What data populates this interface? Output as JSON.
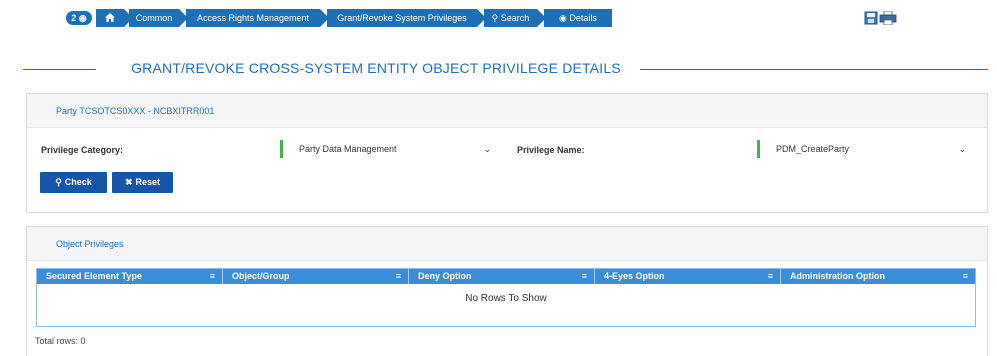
{
  "breadcrumb": {
    "badge": "2",
    "badge_icon": "eye-icon",
    "items": [
      {
        "label": "",
        "icon": "home-icon"
      },
      {
        "label": "Common"
      },
      {
        "label": "Access Rights Management"
      },
      {
        "label": "Grant/Revoke System Privileges"
      },
      {
        "label": "Search",
        "icon": "search-icon"
      },
      {
        "label": "Details",
        "icon": "eye-icon"
      }
    ]
  },
  "toolbar": {
    "icons": [
      "save-icon",
      "print-icon"
    ]
  },
  "page": {
    "title": "GRANT/REVOKE CROSS-SYSTEM ENTITY OBJECT PRIVILEGE DETAILS"
  },
  "party_panel": {
    "header": "Party TCSOTCS0XXX - NCBXITRR001",
    "privilege_category_label": "Privilege Category:",
    "privilege_category_value": "Party Data Management",
    "privilege_name_label": "Privilege Name:",
    "privilege_name_value": "PDM_CreateParty",
    "check_label": "Check",
    "reset_label": "Reset"
  },
  "object_privileges": {
    "header": "Object Privileges",
    "columns": [
      "Secured Element Type",
      "Object/Group",
      "Deny Option",
      "4-Eyes Option",
      "Administration Option"
    ],
    "empty_text": "No Rows To Show",
    "total_rows": "Total rows: 0"
  },
  "colors": {
    "accent": "#1f6fb6",
    "grid_header": "#3a8ed9",
    "required_marker": "#45b34a"
  }
}
